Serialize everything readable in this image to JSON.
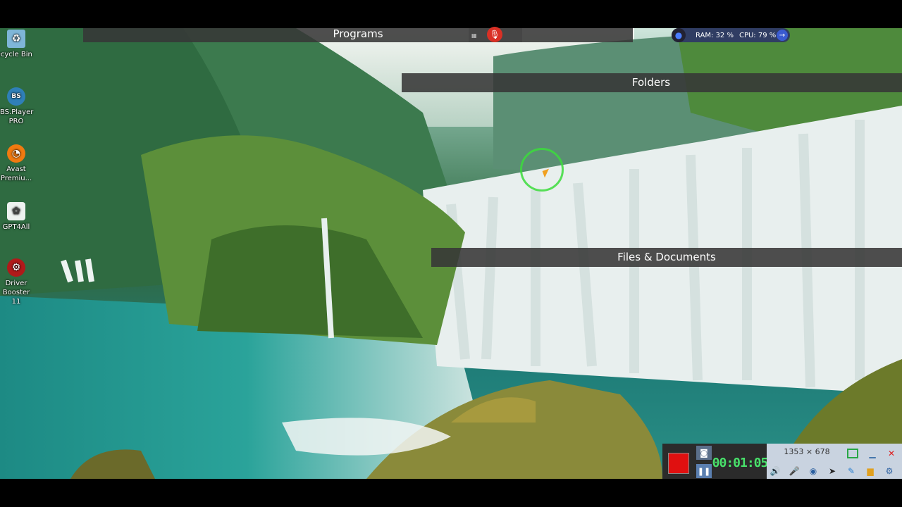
{
  "desktop_icons": [
    {
      "label": "Recycle Bin",
      "icon": "recycle-bin-icon"
    },
    {
      "label": "BS.Player PRO",
      "icon": "bsplayer-icon",
      "glyph": "BS"
    },
    {
      "label": "Avast Premiu...",
      "icon": "avast-icon"
    },
    {
      "label": "GPT4All",
      "icon": "gpt4all-icon"
    },
    {
      "label": "Driver Booster 11",
      "icon": "driver-booster-icon"
    }
  ],
  "fences": {
    "programs": "Programs",
    "folders": "Folders",
    "files": "Files & Documents"
  },
  "system_monitor": {
    "ram": "RAM: 32 %",
    "cpu": "CPU: 79 %"
  },
  "recorder": {
    "timer": "00:01:05",
    "dimensions": "1353 × 678",
    "colors": {
      "stop": "#e01010",
      "timer": "#48e06a"
    }
  }
}
